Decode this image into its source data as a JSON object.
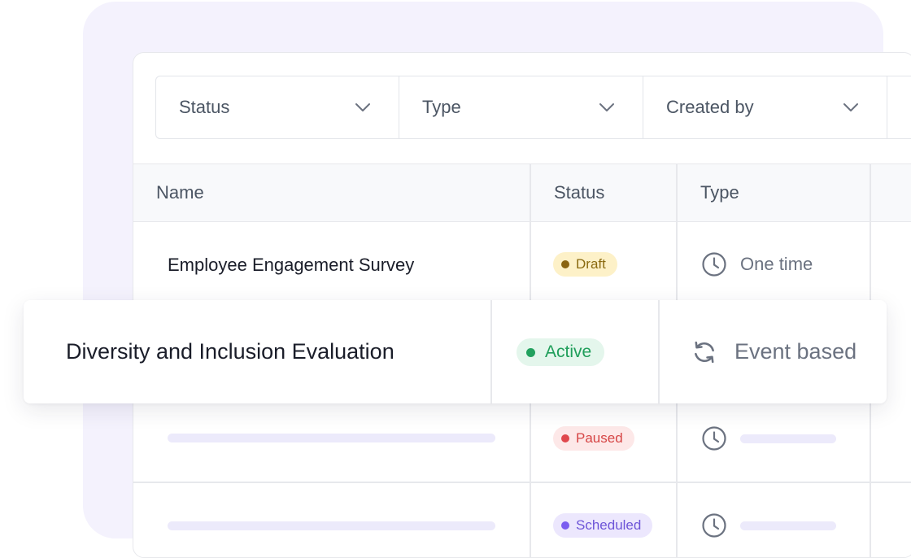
{
  "filters": [
    {
      "label": "Status"
    },
    {
      "label": "Type"
    },
    {
      "label": "Created by"
    }
  ],
  "table": {
    "columns": [
      "Name",
      "Status",
      "Type"
    ],
    "rows": [
      {
        "name": "Employee Engagement Survey",
        "status": "Draft",
        "type": "One time",
        "type_icon": "clock-icon"
      },
      {
        "name": "Diversity and Inclusion Evaluation",
        "status": "Active",
        "type": "Event based",
        "type_icon": "refresh-icon",
        "highlighted": true
      },
      {
        "name": "",
        "status": "Paused",
        "type": "",
        "type_icon": "clock-icon",
        "placeholder": true
      },
      {
        "name": "",
        "status": "Scheduled",
        "type": "",
        "type_icon": "clock-icon",
        "placeholder": true
      }
    ]
  },
  "status_colors": {
    "Draft": {
      "bg": "#fdf1c8",
      "fg": "#8a6a10",
      "dot": "#8a6410"
    },
    "Active": {
      "bg": "#e4f6ec",
      "fg": "#1f9e5a",
      "dot": "#22a15e"
    },
    "Paused": {
      "bg": "#fde8e8",
      "fg": "#d64545",
      "dot": "#e0474c"
    },
    "Scheduled": {
      "bg": "#ece7fd",
      "fg": "#6d55d8",
      "dot": "#7a5cf0"
    }
  }
}
